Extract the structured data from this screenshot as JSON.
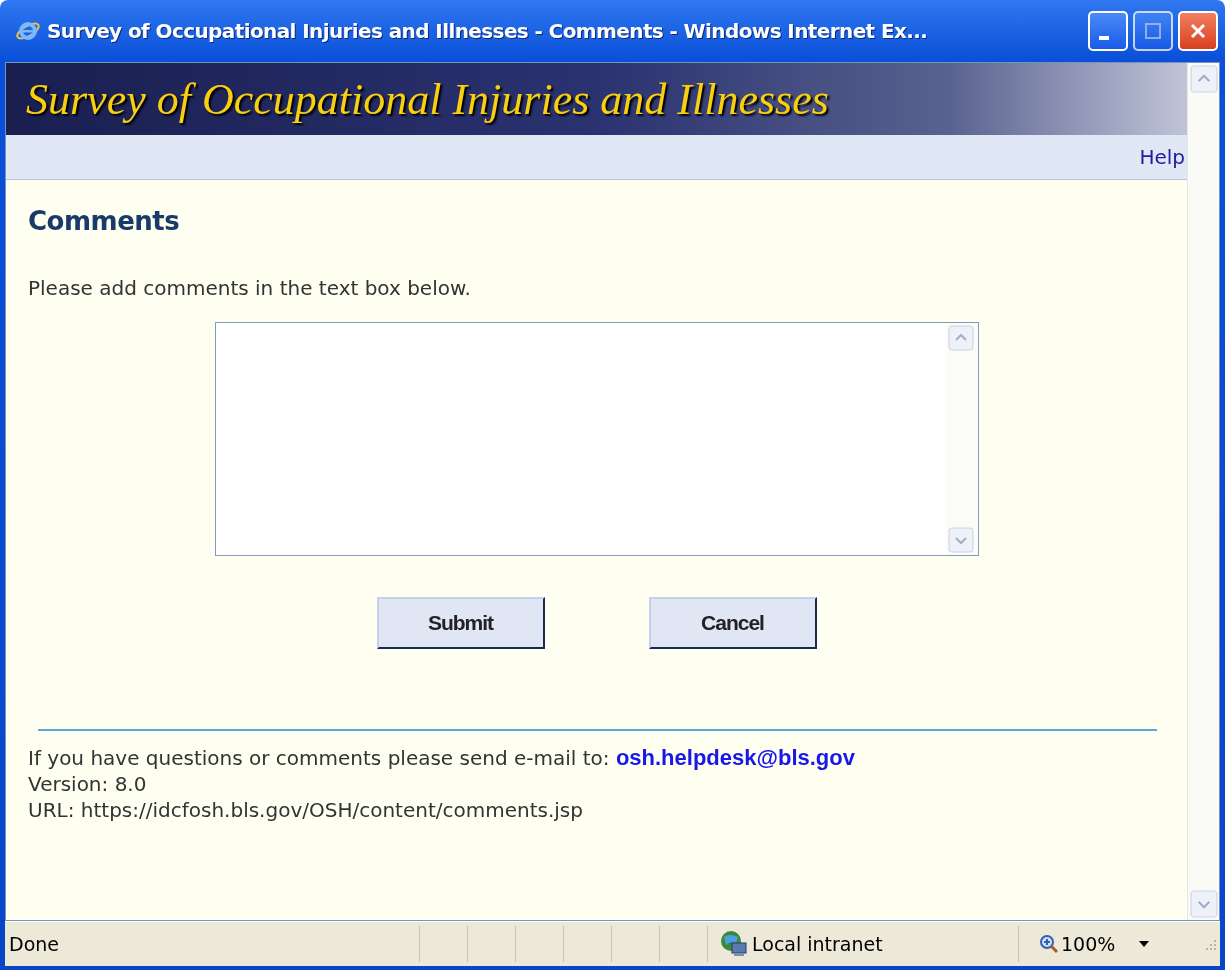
{
  "window": {
    "title": "Survey of Occupational Injuries and Illnesses - Comments - Windows Internet Ex..."
  },
  "banner": {
    "title": "Survey of Occupational Injuries and Illnesses"
  },
  "nav": {
    "help": "Help"
  },
  "page": {
    "heading": "Comments",
    "instruction": "Please add comments in the text box below.",
    "buttons": [
      "Submit",
      "Cancel"
    ]
  },
  "footer": {
    "contact": "If you have questions or comments please send e-mail to:",
    "email": "osh.helpdesk@bls.gov",
    "version": "Version: 8.0",
    "url": "URL: https://idcfosh.bls.gov/OSH/content/comments.jsp"
  },
  "status_bar": {
    "status": "Done",
    "zone": "Local intranet",
    "zoom": "100%"
  }
}
